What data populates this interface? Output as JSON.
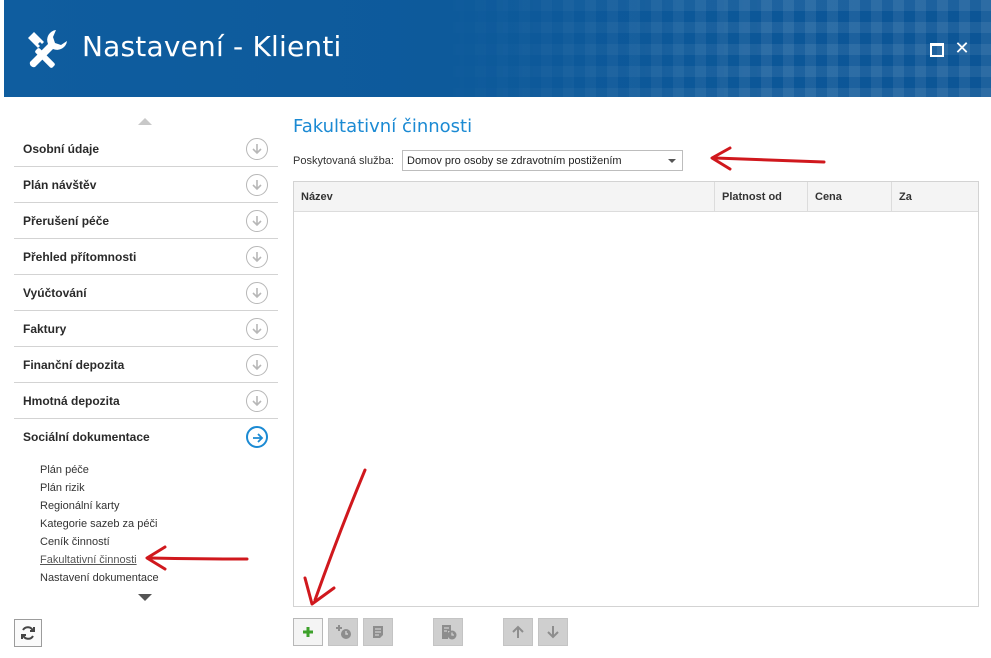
{
  "window": {
    "title": "Nastavení - Klienti",
    "app_icon": "tools-icon",
    "maximize_icon": "maximize-icon",
    "close_label": "✕"
  },
  "sidebar": {
    "items": [
      {
        "label": "Osobní údaje",
        "icon": "chevron-down-circle-icon"
      },
      {
        "label": "Plán návštěv",
        "icon": "chevron-down-circle-icon"
      },
      {
        "label": "Přerušení péče",
        "icon": "chevron-down-circle-icon"
      },
      {
        "label": "Přehled přítomnosti",
        "icon": "chevron-down-circle-icon"
      },
      {
        "label": "Vyúčtování",
        "icon": "chevron-down-circle-icon"
      },
      {
        "label": "Faktury",
        "icon": "chevron-down-circle-icon"
      },
      {
        "label": "Finanční depozita",
        "icon": "chevron-down-circle-icon"
      },
      {
        "label": "Hmotná depozita",
        "icon": "chevron-down-circle-icon"
      },
      {
        "label": "Sociální dokumentace",
        "icon": "arrow-right-circle-icon",
        "active": true
      }
    ],
    "subitems": [
      "Plán péče",
      "Plán rizik",
      "Regionální karty",
      "Kategorie sazeb za péči",
      "Ceník činností",
      "Fakultativní činnosti",
      "Nastavení dokumentace"
    ],
    "active_subitem": "Fakultativní činnosti"
  },
  "main": {
    "title": "Fakultativní činnosti",
    "service_label": "Poskytovaná služba:",
    "service_value": "Domov pro osoby se zdravotním postižením",
    "columns": [
      "Název",
      "Platnost od",
      "Cena",
      "Za"
    ],
    "rows": []
  },
  "toolbar": {
    "buttons": [
      "add-icon",
      "add-history-icon",
      "edit-icon",
      "history-icon",
      "arrow-up-icon",
      "arrow-down-icon"
    ]
  },
  "colors": {
    "titlebar": "#0f5d9f",
    "accent": "#1b8ad3",
    "annotation": "#d0181d",
    "add_green": "#3da12a"
  }
}
